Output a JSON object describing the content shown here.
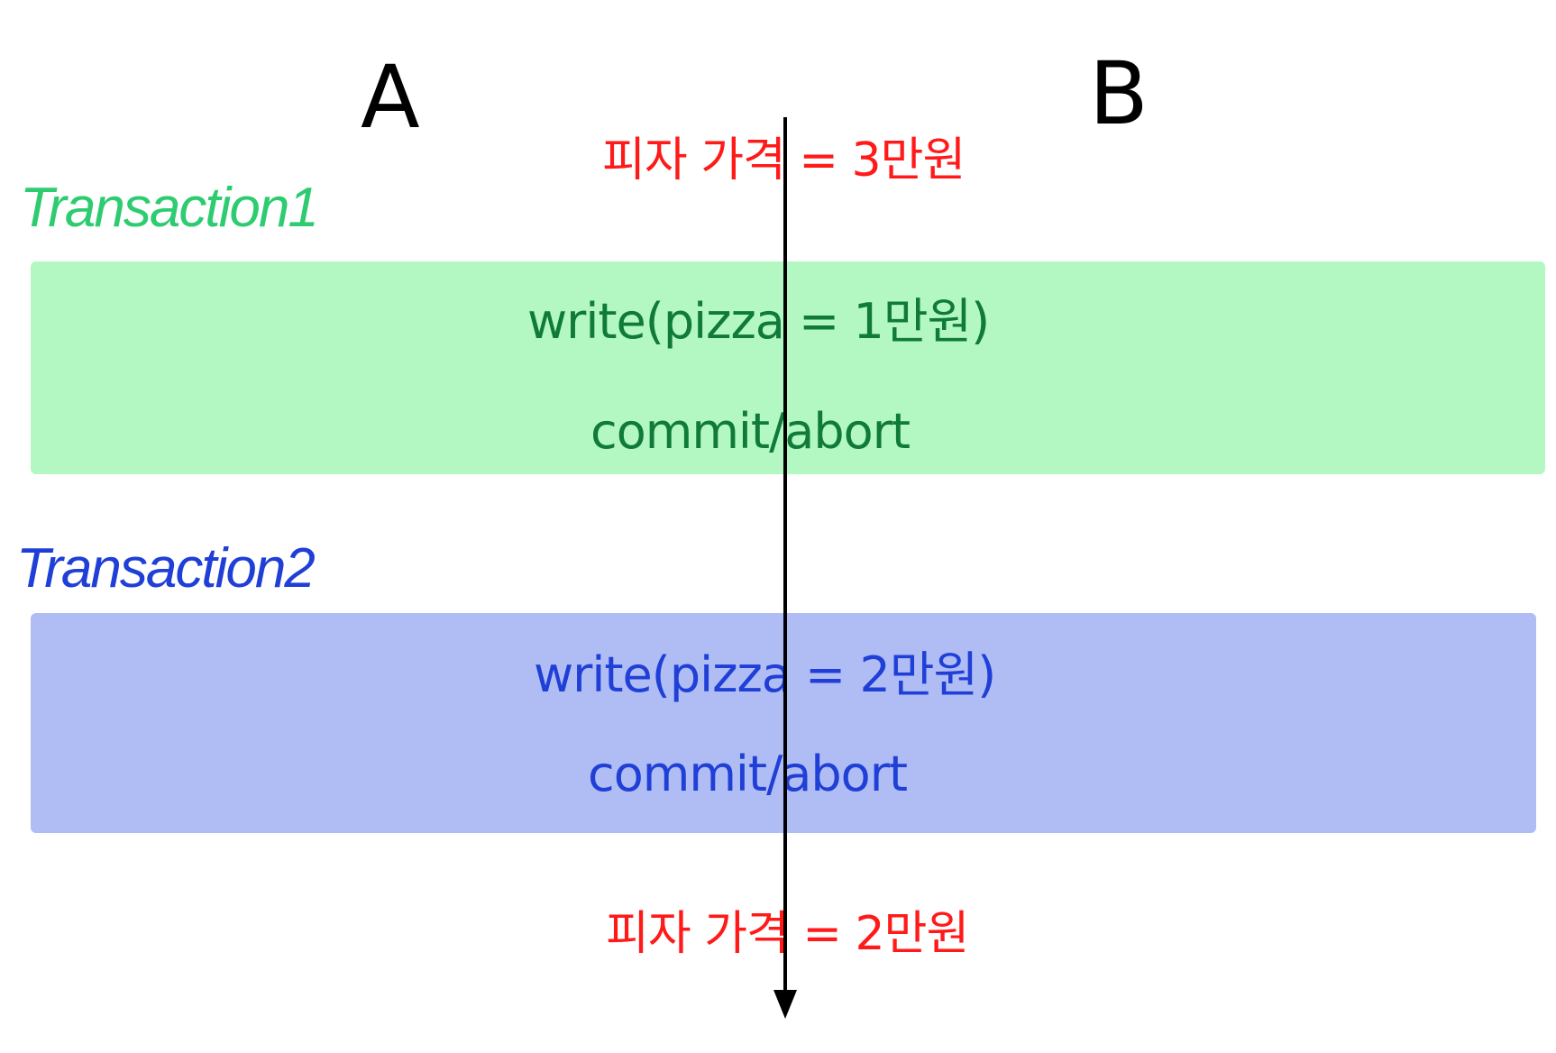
{
  "columns": {
    "a": "A",
    "b": "B"
  },
  "price_top": "피자 가격 = 3만원",
  "price_bottom": "피자 가격 = 2만원",
  "transaction1": {
    "title": "Transaction1",
    "write": "write(pizza = 1만원)",
    "end": "commit/abort",
    "title_color": "#2ecc71",
    "text_color": "#0f7a3a",
    "band_color": "#b3f7c2"
  },
  "transaction2": {
    "title": "Transaction2",
    "write": "write(pizza = 2만원)",
    "end": "commit/abort",
    "title_color": "#1f3fd6",
    "text_color": "#1f3fd6",
    "band_color": "#b0bdf4"
  },
  "colors": {
    "price": "#ff1a1a",
    "timeline": "#000000"
  }
}
